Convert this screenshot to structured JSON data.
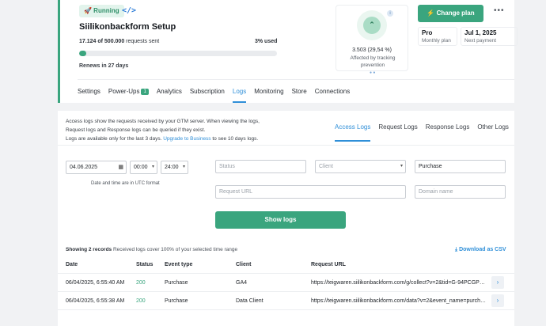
{
  "container": {
    "status_badge": "🚀 Running",
    "code_icon": "</>",
    "name": "Siilikonbackform Setup",
    "requests_used": "17.124 of 500.000",
    "requests_suffix": "requests sent",
    "percent_used": "3% used",
    "progress_fraction": 0.034,
    "renews": "Renews in 27 days",
    "accent_color": "#3aa57e"
  },
  "tracking": {
    "icon": "chevron-up-icon",
    "value": "3.503 (29,54 %)",
    "description": "Affected by tracking prevention"
  },
  "plan": {
    "change_plan_label": "⚡ Change plan",
    "plan_name": "Pro",
    "plan_label": "Monthly plan",
    "next_payment_date": "Jul 1, 2025",
    "next_payment_label": "Next payment"
  },
  "nav": {
    "tabs": [
      {
        "label": "Settings"
      },
      {
        "label": "Power-Ups",
        "badge": "1"
      },
      {
        "label": "Analytics"
      },
      {
        "label": "Subscription"
      },
      {
        "label": "Logs",
        "active": true
      },
      {
        "label": "Monitoring"
      },
      {
        "label": "Store"
      },
      {
        "label": "Connections"
      }
    ]
  },
  "logs": {
    "info_line1": "Access logs show the requests received by your GTM server. When viewing the logs,",
    "info_line2": "Request logs and Response logs can be queried if they exist.",
    "info_line3": "Logs are available only for the last 3 days.",
    "upgrade_link": "Upgrade to Business",
    "info_line3_suffix": "to see 10 days logs.",
    "tabs": [
      {
        "label": "Access Logs",
        "active": true
      },
      {
        "label": "Request Logs"
      },
      {
        "label": "Response Logs"
      },
      {
        "label": "Other Logs"
      }
    ]
  },
  "filters": {
    "date": "04.06.2025",
    "time_from": "00:00",
    "time_to": "24:00",
    "utc_note": "Date and time are in UTC format",
    "status_placeholder": "Status",
    "client_placeholder": "Client",
    "event_value": "Purchase",
    "url_placeholder": "Request URL",
    "domain_placeholder": "Domain name",
    "show_logs_label": "Show logs"
  },
  "results": {
    "records_count": "Showing 2 records",
    "records_coverage": "Received logs cover 100% of your selected time range",
    "csv_label": "Download as CSV",
    "columns": {
      "date": "Date",
      "status": "Status",
      "event": "Event type",
      "client": "Client",
      "url": "Request URL"
    },
    "rows": [
      {
        "date": "06/04/2025, 6:55:40 AM",
        "status": "200",
        "event": "Purchase",
        "client": "GA4",
        "url": "https://teigwaren.siilikonbackform.com/g/collect?v=2&tid=G-94PCGP5P..."
      },
      {
        "date": "06/04/2025, 6:55:38 AM",
        "status": "200",
        "event": "Purchase",
        "client": "Data Client",
        "url": "https://teigwaren.siilikonbackform.com/data?v=2&event_name=purchase..."
      }
    ]
  }
}
